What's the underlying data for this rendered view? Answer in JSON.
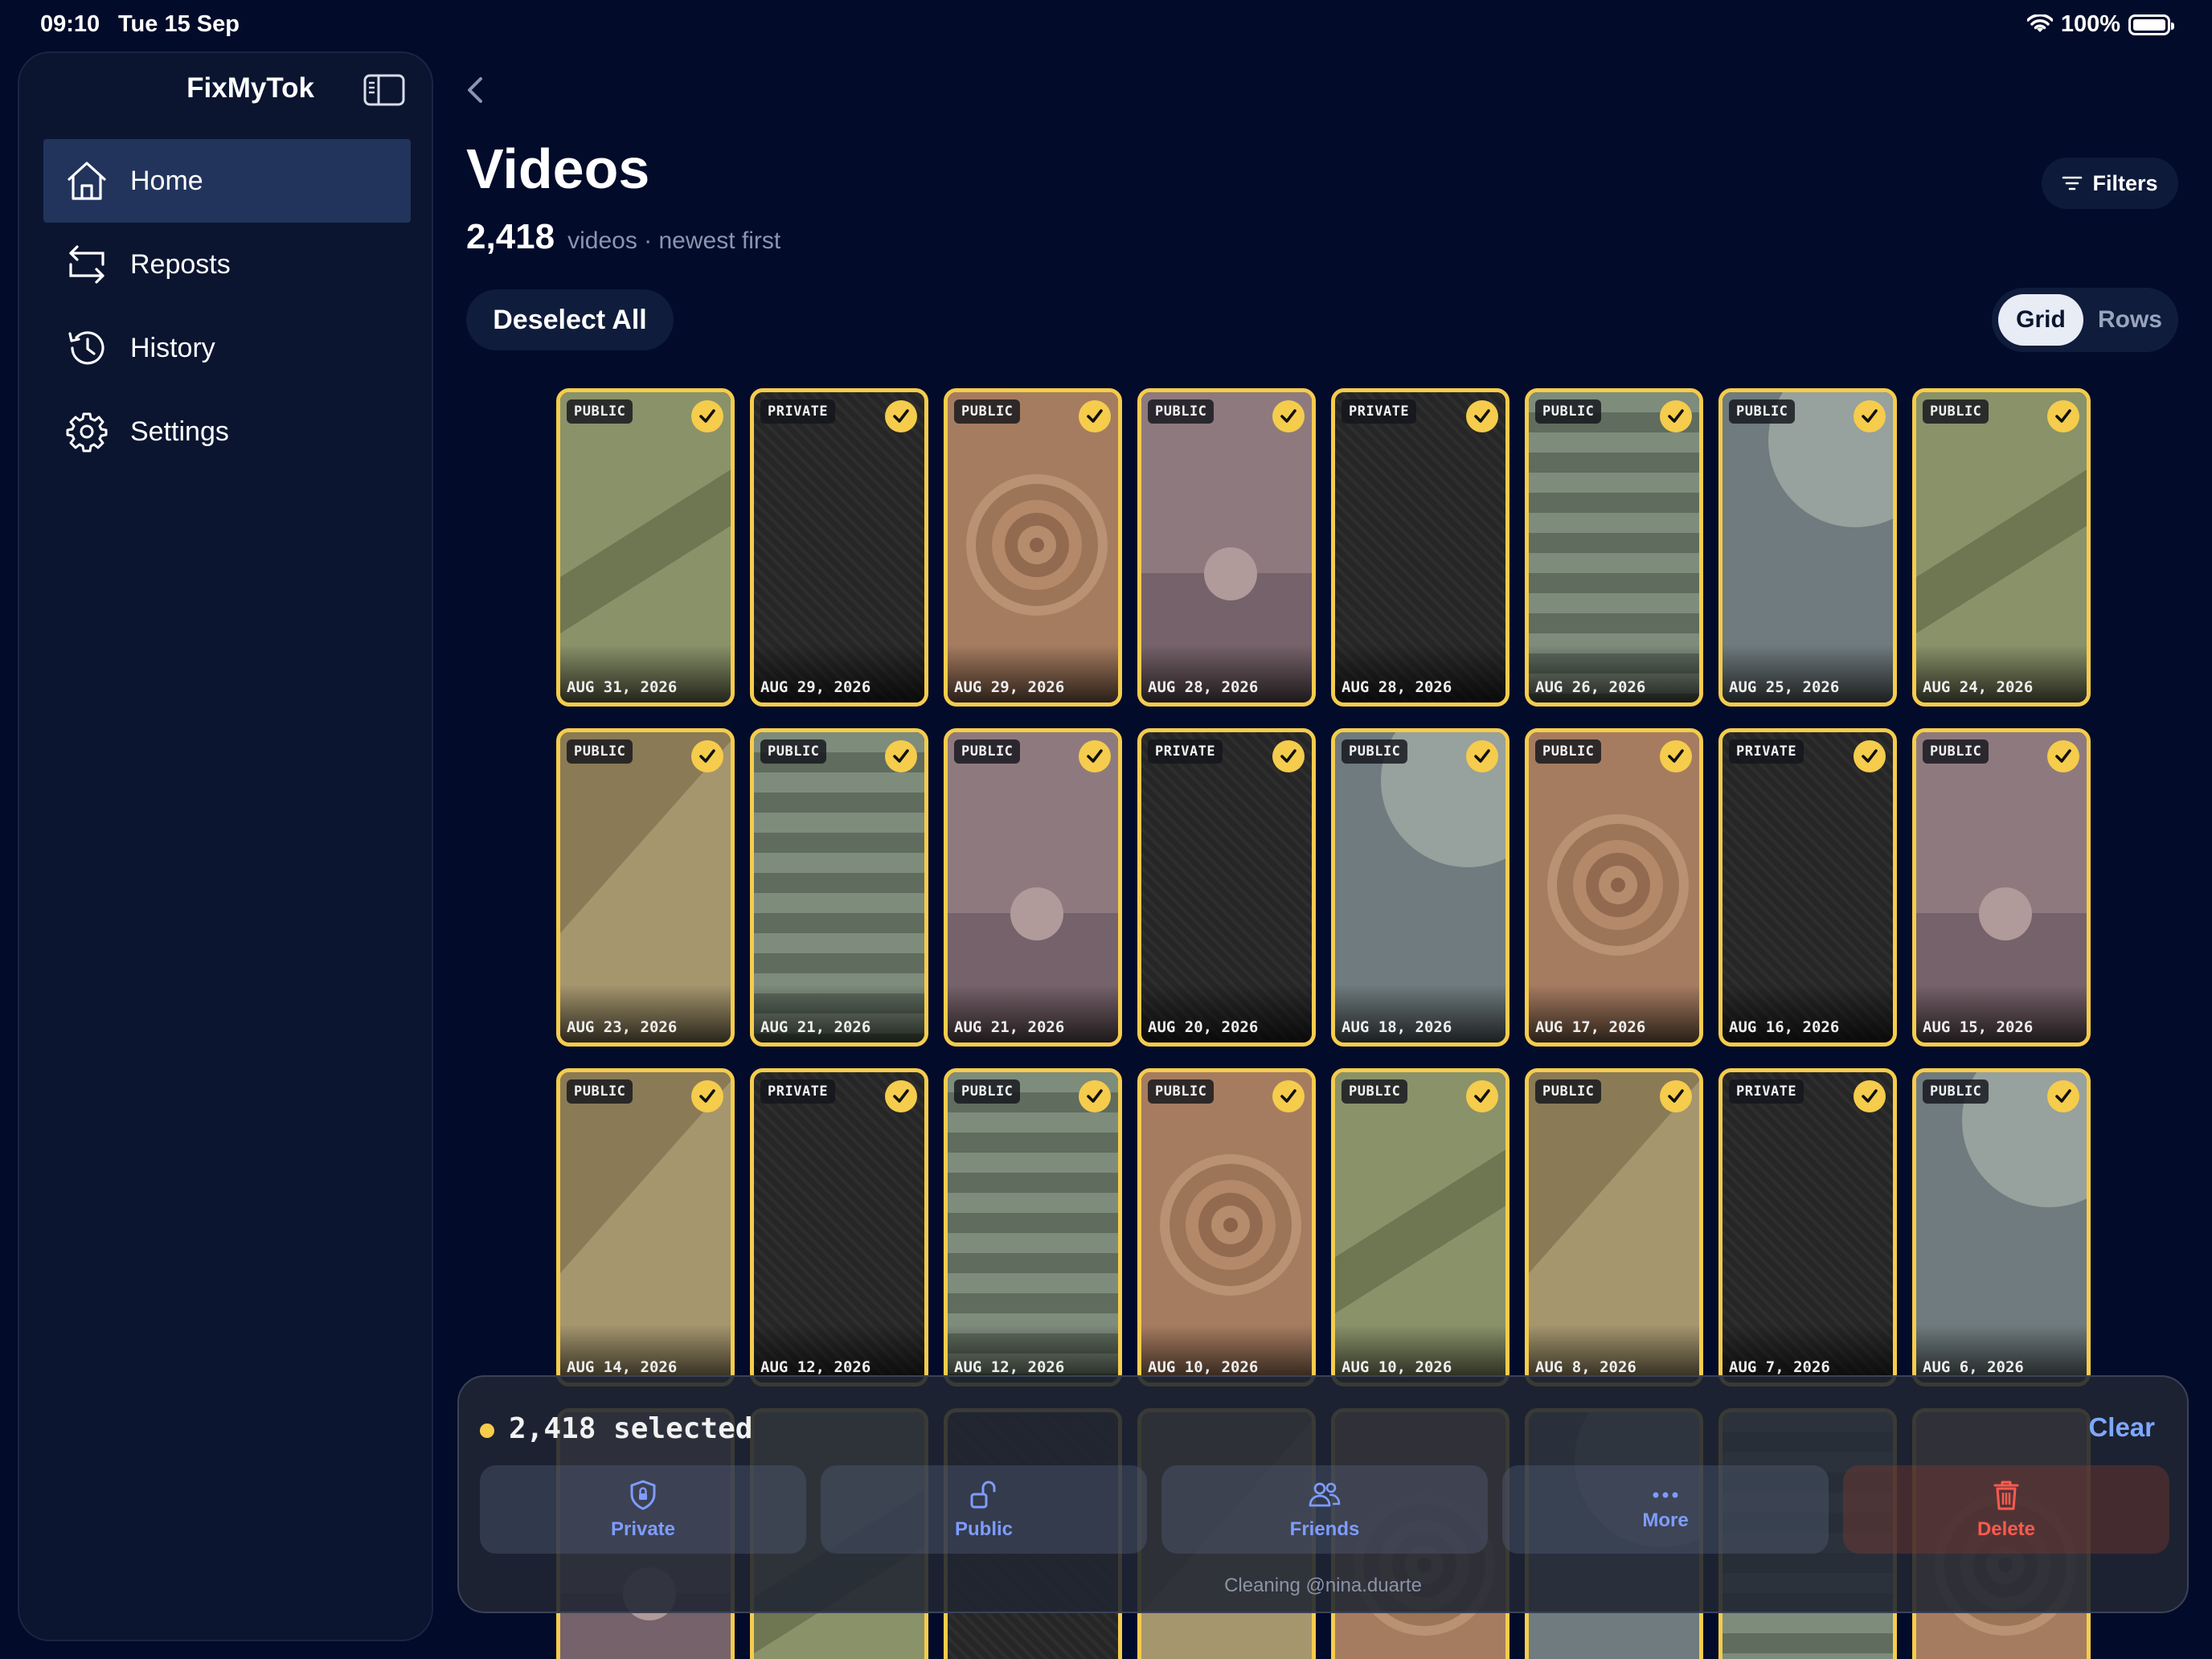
{
  "status": {
    "time": "09:10",
    "date": "Tue 15 Sep",
    "battery": "100%"
  },
  "sidebar": {
    "app_title": "FixMyTok",
    "items": [
      {
        "label": "Home",
        "icon": "home-icon",
        "active": true
      },
      {
        "label": "Reposts",
        "icon": "repost-icon",
        "active": false
      },
      {
        "label": "History",
        "icon": "history-icon",
        "active": false
      },
      {
        "label": "Settings",
        "icon": "gear-icon",
        "active": false
      }
    ]
  },
  "header": {
    "title": "Videos",
    "count": "2,418",
    "count_suffix": "videos · newest first",
    "filters_label": "Filters",
    "deselect_label": "Deselect All",
    "view_options": [
      "Grid",
      "Rows"
    ],
    "view_selected": "Grid"
  },
  "videos": [
    {
      "visibility": "PUBLIC",
      "date": "AUG 31, 2026",
      "art": "olive-diagonal"
    },
    {
      "visibility": "PRIVATE",
      "date": "AUG 29, 2026",
      "art": "dark-stripes"
    },
    {
      "visibility": "PUBLIC",
      "date": "AUG 29, 2026",
      "art": "orange-target"
    },
    {
      "visibility": "PUBLIC",
      "date": "AUG 28, 2026",
      "art": "mauve-sun"
    },
    {
      "visibility": "PRIVATE",
      "date": "AUG 28, 2026",
      "art": "dark-stripes"
    },
    {
      "visibility": "PUBLIC",
      "date": "AUG 26, 2026",
      "art": "green-bands"
    },
    {
      "visibility": "PUBLIC",
      "date": "AUG 25, 2026",
      "art": "grey-moon"
    },
    {
      "visibility": "PUBLIC",
      "date": "AUG 24, 2026",
      "art": "olive-diagonal"
    },
    {
      "visibility": "PUBLIC",
      "date": "AUG 23, 2026",
      "art": "khaki-split"
    },
    {
      "visibility": "PUBLIC",
      "date": "AUG 21, 2026",
      "art": "green-bands"
    },
    {
      "visibility": "PUBLIC",
      "date": "AUG 21, 2026",
      "art": "mauve-sun"
    },
    {
      "visibility": "PRIVATE",
      "date": "AUG 20, 2026",
      "art": "dark-stripes"
    },
    {
      "visibility": "PUBLIC",
      "date": "AUG 18, 2026",
      "art": "grey-moon"
    },
    {
      "visibility": "PUBLIC",
      "date": "AUG 17, 2026",
      "art": "orange-target"
    },
    {
      "visibility": "PRIVATE",
      "date": "AUG 16, 2026",
      "art": "dark-stripes"
    },
    {
      "visibility": "PUBLIC",
      "date": "AUG 15, 2026",
      "art": "mauve-sun"
    },
    {
      "visibility": "PUBLIC",
      "date": "AUG 14, 2026",
      "art": "khaki-split"
    },
    {
      "visibility": "PRIVATE",
      "date": "AUG 12, 2026",
      "art": "dark-stripes"
    },
    {
      "visibility": "PUBLIC",
      "date": "AUG 12, 2026",
      "art": "green-bands"
    },
    {
      "visibility": "PUBLIC",
      "date": "AUG 10, 2026",
      "art": "orange-target"
    },
    {
      "visibility": "PUBLIC",
      "date": "AUG 10, 2026",
      "art": "olive-diagonal"
    },
    {
      "visibility": "PUBLIC",
      "date": "AUG 8, 2026",
      "art": "khaki-split"
    },
    {
      "visibility": "PRIVATE",
      "date": "AUG 7, 2026",
      "art": "dark-stripes"
    },
    {
      "visibility": "PUBLIC",
      "date": "AUG 6, 2026",
      "art": "grey-moon"
    }
  ],
  "selection": {
    "text": "2,418 selected",
    "clear_label": "Clear",
    "actions": [
      {
        "label": "Private",
        "icon": "lock-shield-icon"
      },
      {
        "label": "Public",
        "icon": "unlock-icon"
      },
      {
        "label": "Friends",
        "icon": "friends-icon"
      },
      {
        "label": "More",
        "icon": "more-icon"
      },
      {
        "label": "Delete",
        "icon": "trash-icon"
      }
    ],
    "footer": "Cleaning @nina.duarte"
  },
  "colors": {
    "background": "#020b2a",
    "selection_accent": "#f5cc4c",
    "action_blue": "#7e9cff",
    "delete_red": "#ff5a4e"
  }
}
